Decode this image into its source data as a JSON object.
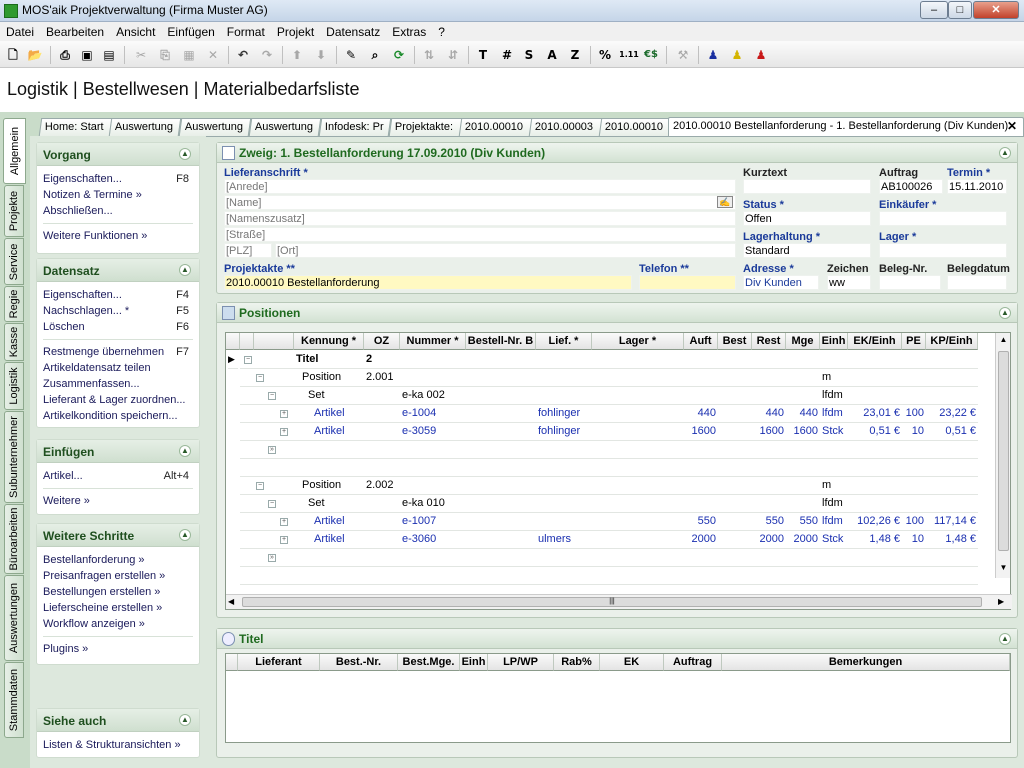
{
  "window": {
    "title": "MOS'aik Projektverwaltung (Firma Muster AG)",
    "min": "–",
    "max": "□",
    "close": "✕"
  },
  "menu": [
    "Datei",
    "Bearbeiten",
    "Ansicht",
    "Einfügen",
    "Format",
    "Projekt",
    "Datensatz",
    "Extras",
    "?"
  ],
  "toolbar": {
    "t": "T",
    "hash": "#",
    "s": "S",
    "a": "A",
    "z": "Z",
    "percent": "%",
    "dec": "1.11",
    "euro": "€$"
  },
  "heading": "Logistik | Bestellwesen | Materialbedarfsliste",
  "vtabs": [
    "Allgemein",
    "Projekte",
    "Service",
    "Regie",
    "Kasse",
    "Logistik",
    "Subunternehmer",
    "Büroarbeiten",
    "Auswertungen",
    "Stammdaten"
  ],
  "doctabs": [
    "Home: Start",
    "Auswertung",
    "Auswertung",
    "Auswertung",
    "Infodesk: Pr",
    "Projektakte:",
    "2010.00010",
    "2010.00003",
    "2010.00010",
    "2010.00010 Bestellanforderung - 1. Bestellanforderung (Div Kunden)"
  ],
  "tabclose": "✕",
  "sidebar": {
    "vorgang": {
      "title": "Vorgang",
      "items": [
        {
          "label": "Eigenschaften...",
          "key": "F8"
        },
        {
          "label": "Notizen & Termine »",
          "key": ""
        },
        {
          "label": "Abschließen...",
          "key": ""
        }
      ],
      "more": "Weitere Funktionen »"
    },
    "datensatz": {
      "title": "Datensatz",
      "items": [
        {
          "label": "Eigenschaften...",
          "key": "F4"
        },
        {
          "label": "Nachschlagen... *",
          "key": "F5"
        },
        {
          "label": "Löschen",
          "key": "F6"
        }
      ],
      "items2": [
        {
          "label": "Restmenge übernehmen",
          "key": "F7"
        },
        {
          "label": "Artikeldatensatz teilen",
          "key": ""
        },
        {
          "label": "Zusammenfassen...",
          "key": ""
        },
        {
          "label": "Lieferant & Lager zuordnen...",
          "key": ""
        },
        {
          "label": "Artikelkondition speichern...",
          "key": ""
        }
      ]
    },
    "einfuegen": {
      "title": "Einfügen",
      "items": [
        {
          "label": "Artikel...",
          "key": "Alt+4"
        }
      ],
      "more": "Weitere »"
    },
    "schritte": {
      "title": "Weitere Schritte",
      "items": [
        "Bestellanforderung »",
        "Preisanfragen erstellen »",
        "Bestellungen erstellen »",
        "Lieferscheine erstellen »",
        "Workflow anzeigen »"
      ],
      "more": "Plugins »"
    },
    "siehe": {
      "title": "Siehe auch",
      "items": [
        "Listen & Strukturansichten »"
      ]
    }
  },
  "zweig": {
    "title": "Zweig: 1. Bestellanforderung 17.09.2010 (Div Kunden)",
    "lieferanschrift_label": "Lieferanschrift *",
    "anrede": "[Anrede]",
    "name": "[Name]",
    "namenszusatz": "[Namenszusatz]",
    "strasse": "[Straße]",
    "plz": "[PLZ]",
    "ort": "[Ort]",
    "kurztext_label": "Kurztext",
    "kurztext": "",
    "auftrag_label": "Auftrag",
    "auftrag": "AB100026",
    "termin_label": "Termin *",
    "termin": "15.11.2010",
    "status_label": "Status *",
    "status": "Offen",
    "einkaeufer_label": "Einkäufer *",
    "einkaeufer": "",
    "lagerhaltung_label": "Lagerhaltung *",
    "lagerhaltung": "Standard",
    "lager_label": "Lager *",
    "lager": "",
    "projektakte_label": "Projektakte **",
    "projektakte": "2010.00010 Bestellanforderung",
    "telefon_label": "Telefon **",
    "telefon": "",
    "adresse_label": "Adresse *",
    "adresse": "Div Kunden",
    "zeichen_label": "Zeichen",
    "zeichen": "ww",
    "belegnr_label": "Beleg-Nr.",
    "belegnr": "",
    "belegdatum_label": "Belegdatum",
    "belegdatum": ""
  },
  "positionen": {
    "title": "Positionen",
    "columns": [
      "Kennung *",
      "OZ",
      "Nummer *",
      "Bestell-Nr. B",
      "Lief. *",
      "Lager *",
      "Auft",
      "Best",
      "Rest",
      "Mge",
      "Einh",
      "EK/Einh",
      "PE",
      "KP/Einh"
    ],
    "rows": [
      {
        "lvl": 0,
        "k": "Titel",
        "oz": "2",
        "nr": "",
        "lief": "",
        "auft": "",
        "best": "",
        "rest": "",
        "mge": "",
        "einh": "",
        "ek": "",
        "pe": "",
        "kp": "",
        "blue": false,
        "bold": true
      },
      {
        "lvl": 1,
        "k": "Position",
        "oz": "2.001",
        "nr": "",
        "lief": "",
        "auft": "",
        "best": "",
        "rest": "",
        "mge": "",
        "einh": "m",
        "ek": "",
        "pe": "",
        "kp": "",
        "blue": false
      },
      {
        "lvl": 2,
        "k": "Set",
        "oz": "",
        "nr": "e-ka 002",
        "lief": "",
        "auft": "",
        "best": "",
        "rest": "",
        "mge": "",
        "einh": "lfdm",
        "ek": "",
        "pe": "",
        "kp": "",
        "blue": false
      },
      {
        "lvl": 3,
        "k": "Artikel",
        "oz": "",
        "nr": "e-1004",
        "lief": "fohlinger",
        "auft": "440",
        "best": "",
        "rest": "440",
        "mge": "440",
        "einh": "lfdm",
        "ek": "23,01 €",
        "pe": "100",
        "kp": "23,22 €",
        "blue": true
      },
      {
        "lvl": 3,
        "k": "Artikel",
        "oz": "",
        "nr": "e-3059",
        "lief": "fohlinger",
        "auft": "1600",
        "best": "",
        "rest": "1600",
        "mge": "1600",
        "einh": "Stck",
        "ek": "0,51 €",
        "pe": "10",
        "kp": "0,51 €",
        "blue": true
      },
      {
        "lvl": -1
      },
      {
        "lvl": -1
      },
      {
        "lvl": 1,
        "k": "Position",
        "oz": "2.002",
        "nr": "",
        "lief": "",
        "auft": "",
        "best": "",
        "rest": "",
        "mge": "",
        "einh": "m",
        "ek": "",
        "pe": "",
        "kp": "",
        "blue": false
      },
      {
        "lvl": 2,
        "k": "Set",
        "oz": "",
        "nr": "e-ka 010",
        "lief": "",
        "auft": "",
        "best": "",
        "rest": "",
        "mge": "",
        "einh": "lfdm",
        "ek": "",
        "pe": "",
        "kp": "",
        "blue": false
      },
      {
        "lvl": 3,
        "k": "Artikel",
        "oz": "",
        "nr": "e-1007",
        "lief": "",
        "auft": "550",
        "best": "",
        "rest": "550",
        "mge": "550",
        "einh": "lfdm",
        "ek": "102,26 €",
        "pe": "100",
        "kp": "117,14 €",
        "blue": true
      },
      {
        "lvl": 3,
        "k": "Artikel",
        "oz": "",
        "nr": "e-3060",
        "lief": "ulmers",
        "auft": "2000",
        "best": "",
        "rest": "2000",
        "mge": "2000",
        "einh": "Stck",
        "ek": "1,48 €",
        "pe": "10",
        "kp": "1,48 €",
        "blue": true
      },
      {
        "lvl": -1
      },
      {
        "lvl": -1
      }
    ]
  },
  "titel": {
    "title": "Titel",
    "columns": [
      "Lieferant",
      "Best.-Nr.",
      "Best.Mge.",
      "Einh",
      "LP/WP",
      "Rab%",
      "EK",
      "Auftrag",
      "Bemerkungen"
    ]
  },
  "colors": {
    "accent": "#1f6a1f",
    "link": "#1a3a9a",
    "bg": "#c9dcc9"
  }
}
